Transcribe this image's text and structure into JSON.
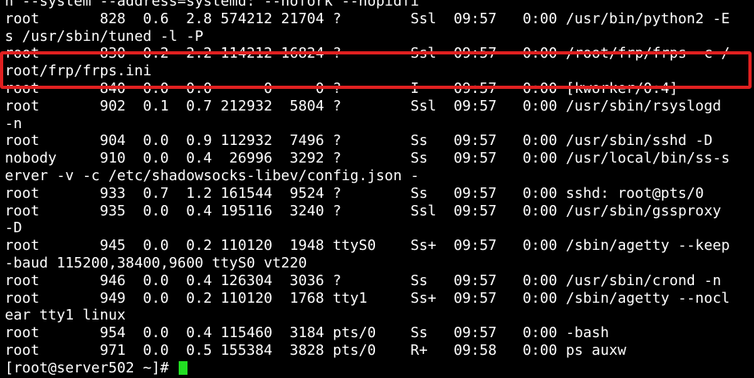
{
  "terminal": {
    "lines": [
      "n --system --address=systemd: --nofork --nopidfi",
      "root       828  0.6  2.8 574212 21704 ?        Ssl  09:57   0:00 /usr/bin/python2 -E",
      "s /usr/sbin/tuned -l -P",
      "root       830  0.2  2.2 114212 16824 ?        Ssl  09:57   0:00 /root/frp/frps -c /",
      "root/frp/frps.ini",
      "root       840  0.0  0.0      0     0 ?        I    09:57   0:00 [kworker/0:4]",
      "root       902  0.1  0.7 212932  5804 ?        Ssl  09:57   0:00 /usr/sbin/rsyslogd",
      "-n",
      "root       904  0.0  0.9 112932  7496 ?        Ss   09:57   0:00 /usr/sbin/sshd -D",
      "nobody     910  0.0  0.4  26996  3292 ?        Ss   09:57   0:00 /usr/local/bin/ss-s",
      "erver -v -c /etc/shadowsocks-libev/config.json -",
      "root       933  0.7  1.2 161544  9524 ?        Ss   09:57   0:00 sshd: root@pts/0",
      "root       935  0.0  0.4 195116  3240 ?        Ssl  09:57   0:00 /usr/sbin/gssproxy",
      "-D",
      "root       945  0.0  0.2 110120  1948 ttyS0    Ss+  09:57   0:00 /sbin/agetty --keep",
      "-baud 115200,38400,9600 ttyS0 vt220",
      "root       946  0.0  0.4 126304  3036 ?        Ss   09:57   0:00 /usr/sbin/crond -n",
      "root       949  0.0  0.2 110120  1768 tty1     Ss+  09:57   0:00 /sbin/agetty --nocl",
      "ear tty1 linux",
      "root       954  0.0  0.4 115460  3184 pts/0    Ss   09:57   0:00 -bash",
      "root       971  0.0  0.5 155384  3828 pts/0    R+   09:58   0:00 ps auxw"
    ],
    "prompt": "[root@server502 ~]# ",
    "colors": {
      "background": "#000000",
      "text": "#ffffff",
      "cursor": "#22dd22",
      "highlight": "#e02020"
    }
  }
}
